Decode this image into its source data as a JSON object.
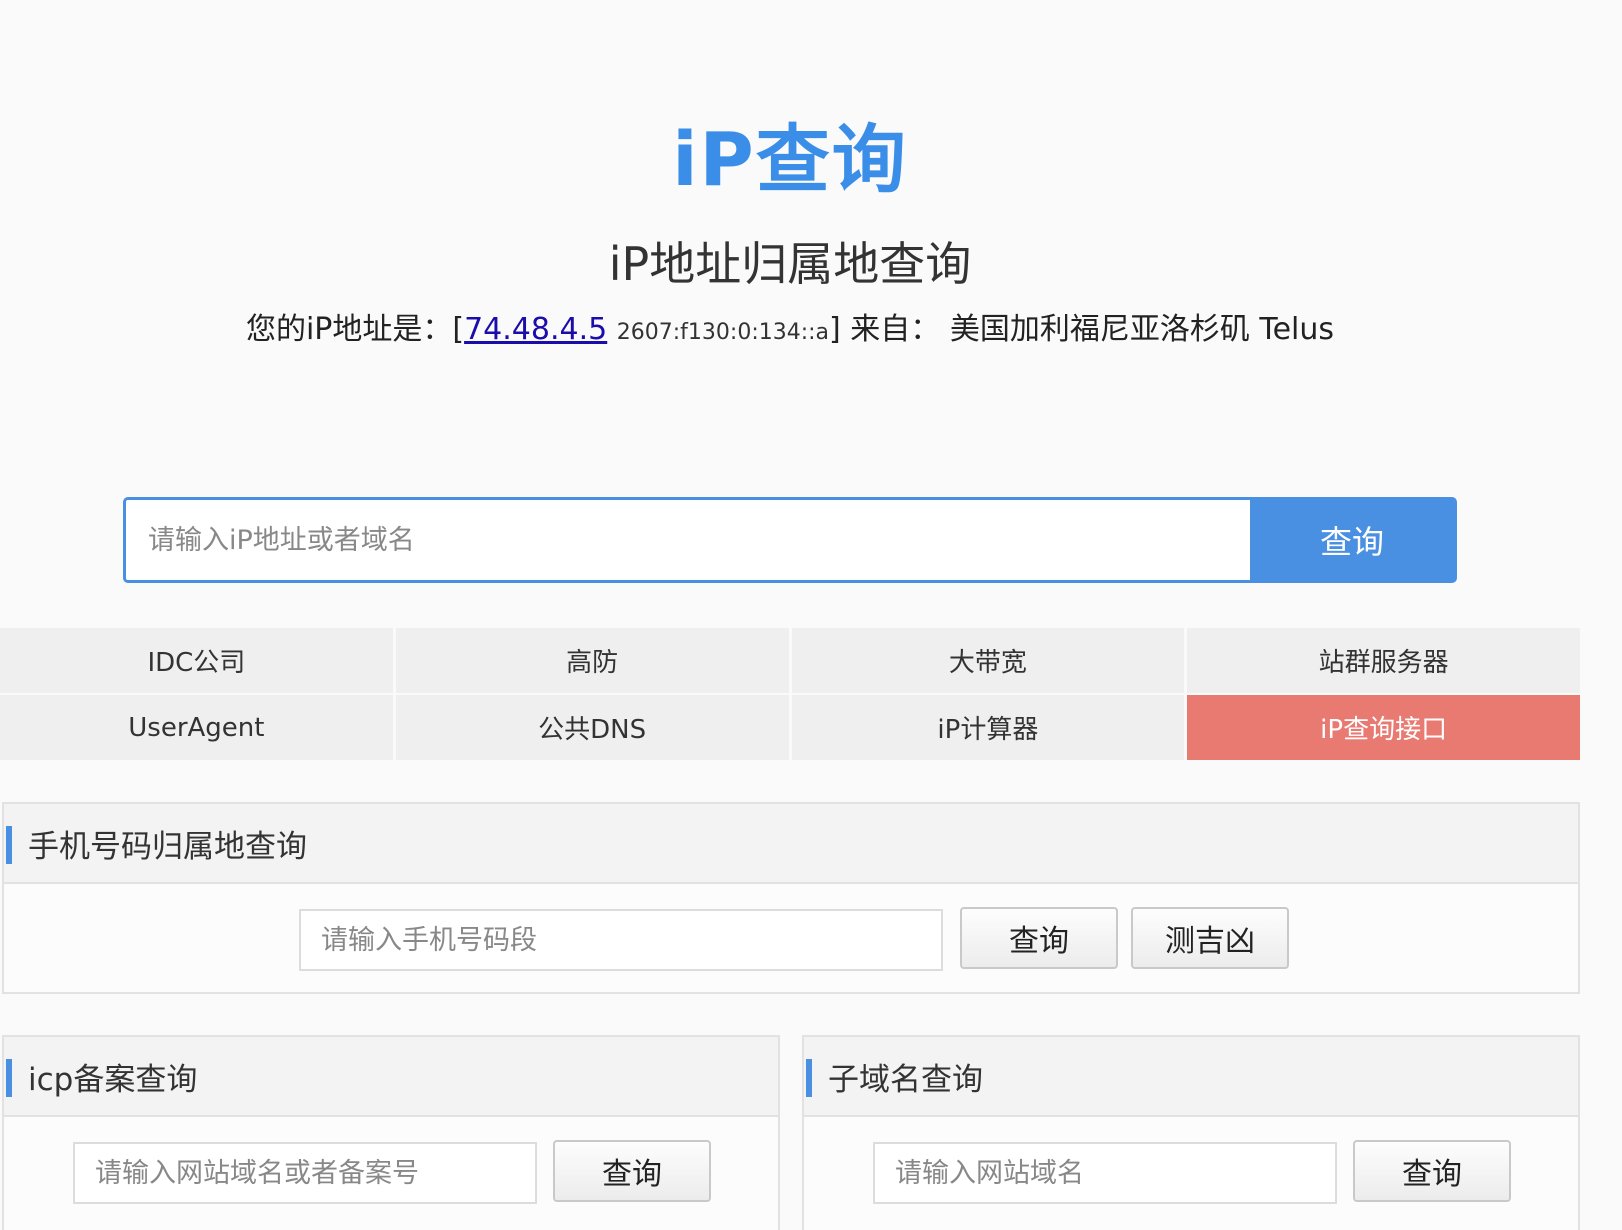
{
  "logo": "iP查询",
  "subtitle": "iP地址归属地查询",
  "ip_info": {
    "prefix": "您的iP地址是：[",
    "ipv4": "74.48.4.5",
    "ipv6": "2607:f130:0:134::a",
    "suffix": "] 来自：  美国加利福尼亚洛杉矶 Telus"
  },
  "search": {
    "placeholder": "请输入iP地址或者域名",
    "button": "查询"
  },
  "tools": [
    {
      "label": "IDC公司"
    },
    {
      "label": "高防"
    },
    {
      "label": "大带宽"
    },
    {
      "label": "站群服务器"
    },
    {
      "label": "UserAgent"
    },
    {
      "label": "公共DNS"
    },
    {
      "label": "iP计算器"
    },
    {
      "label": "iP查询接口",
      "active": true
    }
  ],
  "phone_panel": {
    "title": "手机号码归属地查询",
    "placeholder": "请输入手机号码段",
    "query_button": "查询",
    "fortune_button": "测吉凶"
  },
  "icp_panel": {
    "title": "icp备案查询",
    "placeholder": "请输入网站域名或者备案号",
    "query_button": "查询"
  },
  "subdomain_panel": {
    "title": "子域名查询",
    "placeholder": "请输入网站域名",
    "query_button": "查询"
  },
  "colors": {
    "accent": "#4a90e2",
    "active_tool": "#e87a72",
    "link": "#1a0dab"
  }
}
